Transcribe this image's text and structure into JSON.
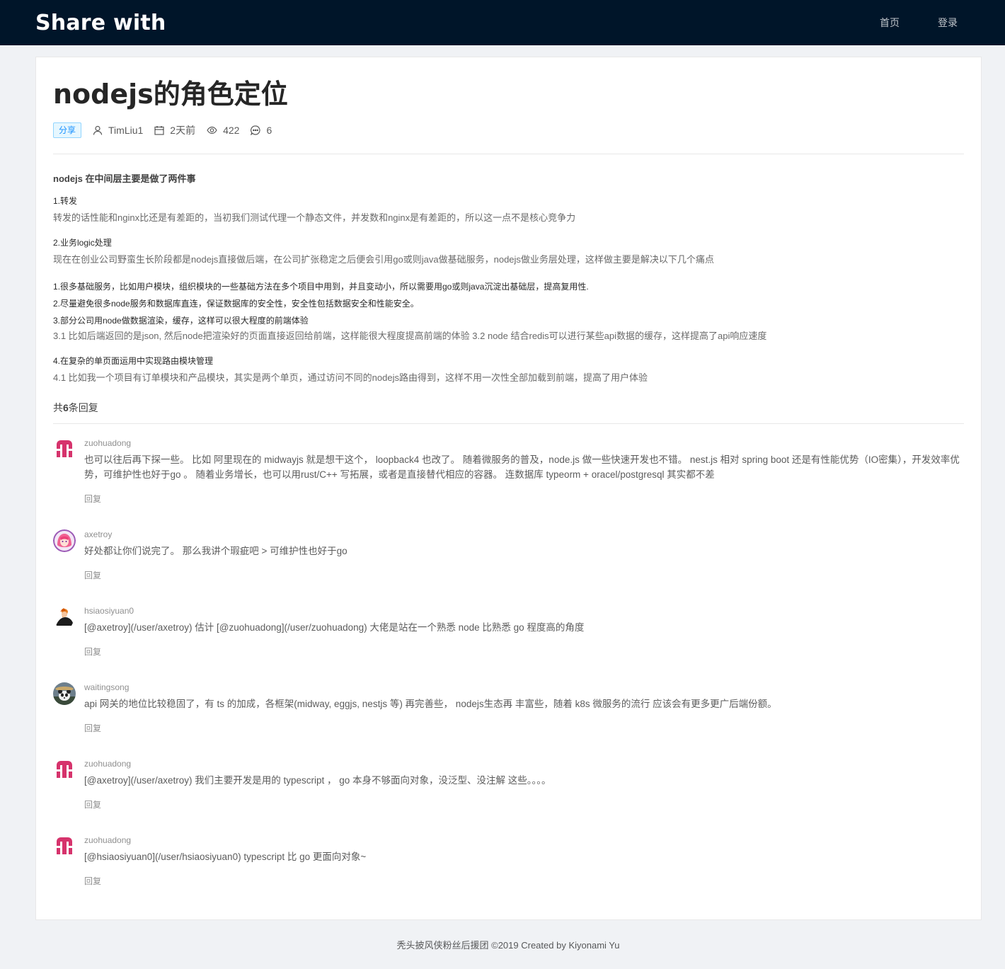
{
  "header": {
    "logo": "Share with",
    "nav": [
      {
        "label": "首页"
      },
      {
        "label": "登录"
      }
    ]
  },
  "post": {
    "title": "nodejs的角色定位",
    "tag": "分享",
    "author": "TimLiu1",
    "time": "2天前",
    "views": "422",
    "comments": "6",
    "icons": [
      "user-icon",
      "calendar-icon",
      "eye-icon",
      "comment-icon"
    ]
  },
  "content": {
    "intro": "nodejs 在中间层主要是做了两件事",
    "s1_title": "1.转发",
    "s1_text": "转发的话性能和nginx比还是有差距的，当初我们测试代理一个静态文件，并发数和nginx是有差距的，所以这一点不是核心竞争力",
    "s2_title": "2.业务logic处理",
    "s2_text": "现在在创业公司野蛮生长阶段都是nodejs直接做后端，在公司扩张稳定之后便会引用go或则java做基础服务，nodejs做业务层处理，这样做主要是解决以下几个痛点",
    "li1": "1.很多基础服务，比如用户模块，组织模块的一些基础方法在多个项目中用到，并且变动小，所以需要用go或则java沉淀出基础层，提高复用性.",
    "li2": "2.尽量避免很多node服务和数据库直连，保证数据库的安全性，安全性包括数据安全和性能安全。",
    "li3": "3.部分公司用node做数据渲染，缓存，这样可以很大程度的前端体验",
    "s3_text": "3.1 比如后端返回的是json, 然后node把渲染好的页面直接返回给前端，这样能很大程度提高前端的体验 3.2 node 结合redis可以进行某些api数据的缓存，这样提高了api响应速度",
    "s4_title": "4.在复杂的单页面运用中实现路由模块管理",
    "s4_text": "4.1 比如我一个项目有订单模块和产品模块，其实是两个单页，通过访问不同的nodejs路由得到，这样不用一次性全部加载到前端，提高了用户体验"
  },
  "replies": {
    "prefix": "共",
    "count": "6",
    "suffix": "条回复",
    "reply_label": "回复",
    "items": [
      {
        "author": "zuohuadong",
        "avatar": "pink-logo",
        "text": "也可以往后再下探一些。  比如 阿里现在的 midwayjs 就是想干这个，  loopback4 也改了。  随着微服务的普及，node.js 做一些快速开发也不错。  nest.js 相对 spring boot 还是有性能优势（IO密集），开发效率优势，可维护性也好于go 。 随着业务增长，也可以用rust/C++ 写拓展，或者是直接替代相应的容器。  连数据库 typeorm + oracel/postgresql 其实都不差"
      },
      {
        "author": "axetroy",
        "avatar": "anime-girl",
        "text": "好处都让你们说完了。 那么我讲个瑕疵吧  > 可维护性也好于go"
      },
      {
        "author": "hsiaosiyuan0",
        "avatar": "dark-figure",
        "text": "[@axetroy](/user/axetroy) 估计 [@zuohuadong](/user/zuohuadong) 大佬是站在一个熟悉 node 比熟悉 go 程度高的角度"
      },
      {
        "author": "waitingsong",
        "avatar": "panda",
        "text": "api 网关的地位比较稳固了，有 ts 的加成，各框架(midway, eggjs, nestjs 等) 再完善些，  nodejs生态再 丰富些，随着 k8s 微服务的流行 应该会有更多更广后端份额。"
      },
      {
        "author": "zuohuadong",
        "avatar": "pink-logo",
        "text": "[@axetroy](/user/axetroy) 我们主要开发是用的 typescript ，  go 本身不够面向对象，没泛型、没注解 这些。。。。"
      },
      {
        "author": "zuohuadong",
        "avatar": "pink-logo",
        "text": "[@hsiaosiyuan0](/user/hsiaosiyuan0) typescript 比 go 更面向对象~"
      }
    ]
  },
  "footer": {
    "text": "秃头披风侠粉丝后援团 ©2019 Created by Kiyonami Yu"
  }
}
